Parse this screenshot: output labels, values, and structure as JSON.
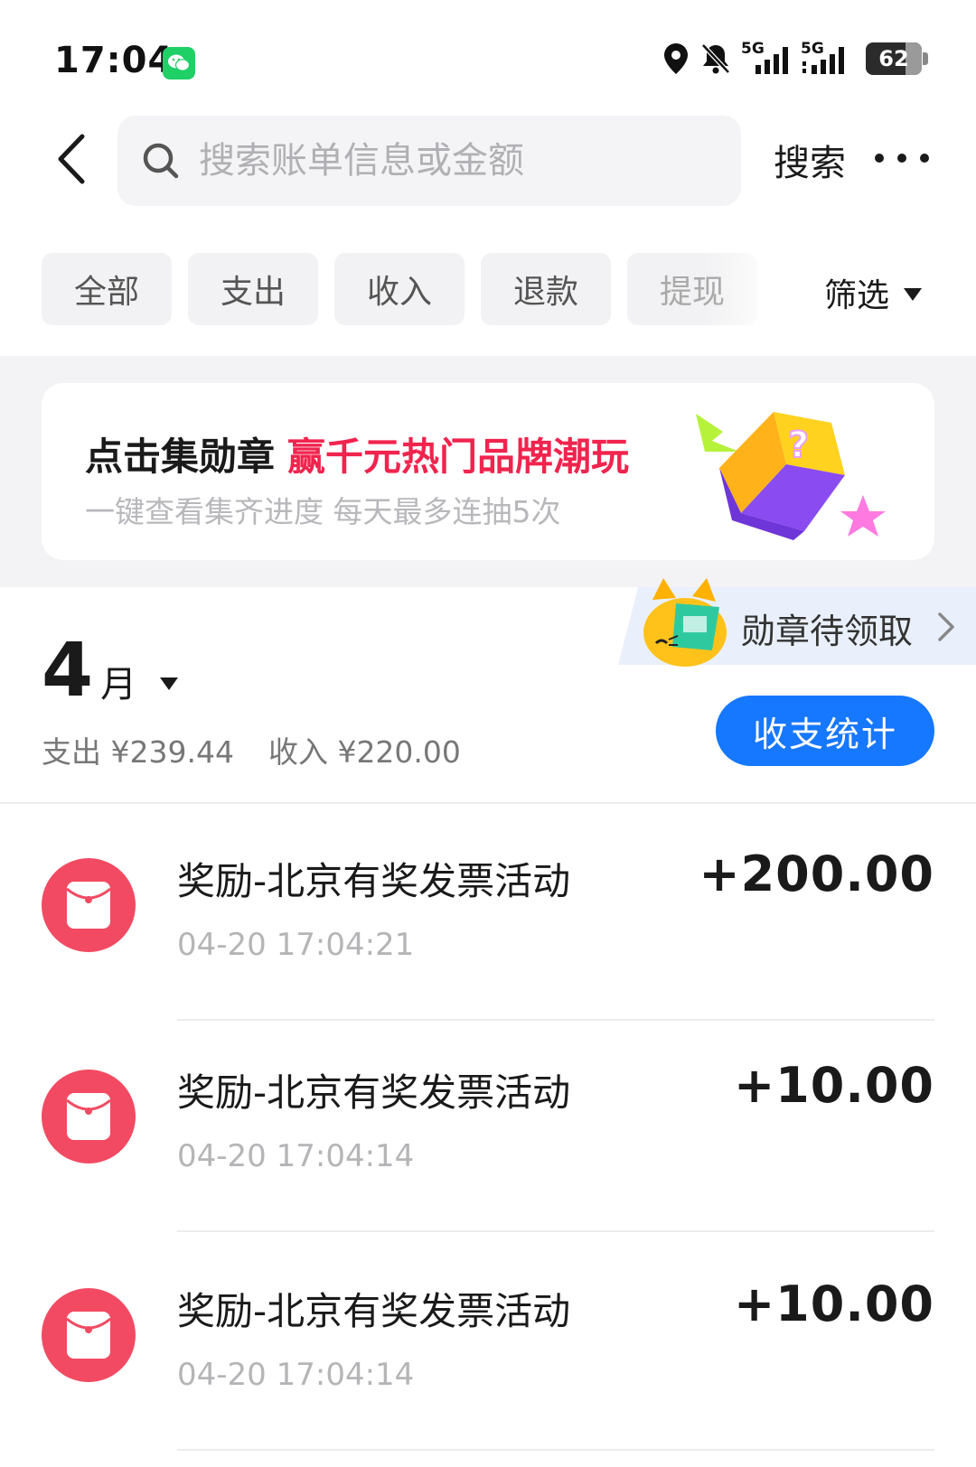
{
  "status_bar": {
    "time": "17:04",
    "battery": "62",
    "network_1": "5G",
    "network_2": "5G"
  },
  "header": {
    "search_placeholder": "搜索账单信息或金额",
    "search_button": "搜索"
  },
  "filters": {
    "chips": [
      "全部",
      "支出",
      "收入",
      "退款",
      "提现"
    ],
    "dropdown_label": "筛选"
  },
  "banner": {
    "title": "点击集勋章",
    "title_highlight": "赢千元热门品牌潮玩",
    "subtitle": "一键查看集齐进度 每天最多连抽5次",
    "highlight_color": "#f0244e"
  },
  "medal_tab": {
    "label": "勋章待领取"
  },
  "month": {
    "number": "4",
    "unit": "月",
    "expense": "支出 ¥239.44",
    "income": "收入 ¥220.00",
    "stats_button": "收支统计",
    "accent_color": "#1677ff"
  },
  "transactions": [
    {
      "title": "奖励-北京有奖发票活动",
      "time": "04-20 17:04:21",
      "amount": "+200.00",
      "icon": "red-envelope-icon"
    },
    {
      "title": "奖励-北京有奖发票活动",
      "time": "04-20 17:04:14",
      "amount": "+10.00",
      "icon": "red-envelope-icon"
    },
    {
      "title": "奖励-北京有奖发票活动",
      "time": "04-20 17:04:14",
      "amount": "+10.00",
      "icon": "red-envelope-icon"
    }
  ]
}
